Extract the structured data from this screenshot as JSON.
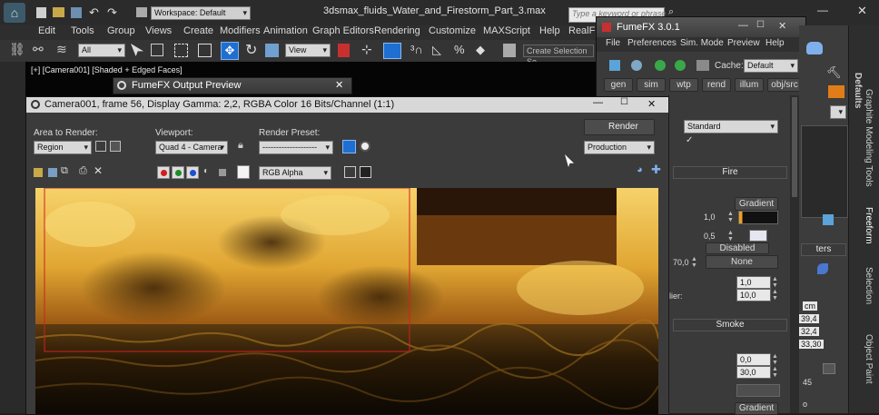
{
  "colors": {
    "accent_blue": "#1e6fd1",
    "fire_light": "#f2c24a",
    "fire_dark": "#6b3a0c",
    "ocean": "#1a1408",
    "region_red": "#d22020"
  },
  "titlebar": {
    "workspace_label": "Workspace: Default",
    "file_title": "3dsmax_fluids_Water_and_Firestorm_Part_3.max",
    "search_placeholder": "Type a keyword or phrase"
  },
  "menubar": {
    "items": [
      "Edit",
      "Tools",
      "Group",
      "Views",
      "Create",
      "Modifiers",
      "Animation",
      "Graph Editors",
      "Rendering",
      "Customize",
      "MAXScript",
      "Help",
      "RealFl"
    ]
  },
  "toolbar": {
    "filter_value": "All",
    "refcoord_value": "View",
    "selection_set_placeholder": "Create Selection Se"
  },
  "viewport": {
    "label": "[+] [Camera001] [Shaded + Edged Faces]"
  },
  "output_preview": {
    "title": "FumeFX Output Preview"
  },
  "frame_window": {
    "title": "Camera001, frame 56, Display Gamma: 2,2, RGBA Color 16 Bits/Channel (1:1)",
    "area_label": "Area to Render:",
    "area_value": "Region",
    "viewport_label": "Viewport:",
    "viewport_value": "Quad 4 - Camera",
    "preset_label": "Render Preset:",
    "preset_value": "--------------------",
    "render_button": "Render",
    "production_value": "Production",
    "channel_value": "RGB Alpha"
  },
  "fumefx": {
    "title": "FumeFX 3.0.1",
    "menu": [
      "File",
      "Preferences",
      "Sim. Mode",
      "Preview",
      "Help"
    ],
    "cache_label": "Cache:",
    "cache_value": "Default",
    "tabs": [
      "gen",
      "sim",
      "wtp",
      "rend",
      "illum",
      "obj/src"
    ],
    "shader_value": "Standard",
    "fire_header": "Fire",
    "gradient_label": "Gradient",
    "val_1_0": "1,0",
    "val_0_5": "0,5",
    "disabled_label": "Disabled",
    "val_70": "70,0",
    "none_label": "None",
    "val_1_0b": "1,0",
    "val_10_0": "10,0",
    "partial_label": "lier:",
    "smoke_header": "Smoke",
    "val_0_0": "0,0",
    "val_30_0": "30,0",
    "gradient_label2": "Gradient"
  },
  "cmdpanel": {
    "ters_label": "ters",
    "values": [
      "cm",
      "39,4",
      "32,4",
      "33,30",
      "45",
      "o"
    ]
  },
  "ribbon_tabs": {
    "defaults": "Defaults",
    "graphite": "Graphite Modeling Tools",
    "freeform": "Freeform",
    "selection": "Selection",
    "object_paint": "Object Paint"
  }
}
